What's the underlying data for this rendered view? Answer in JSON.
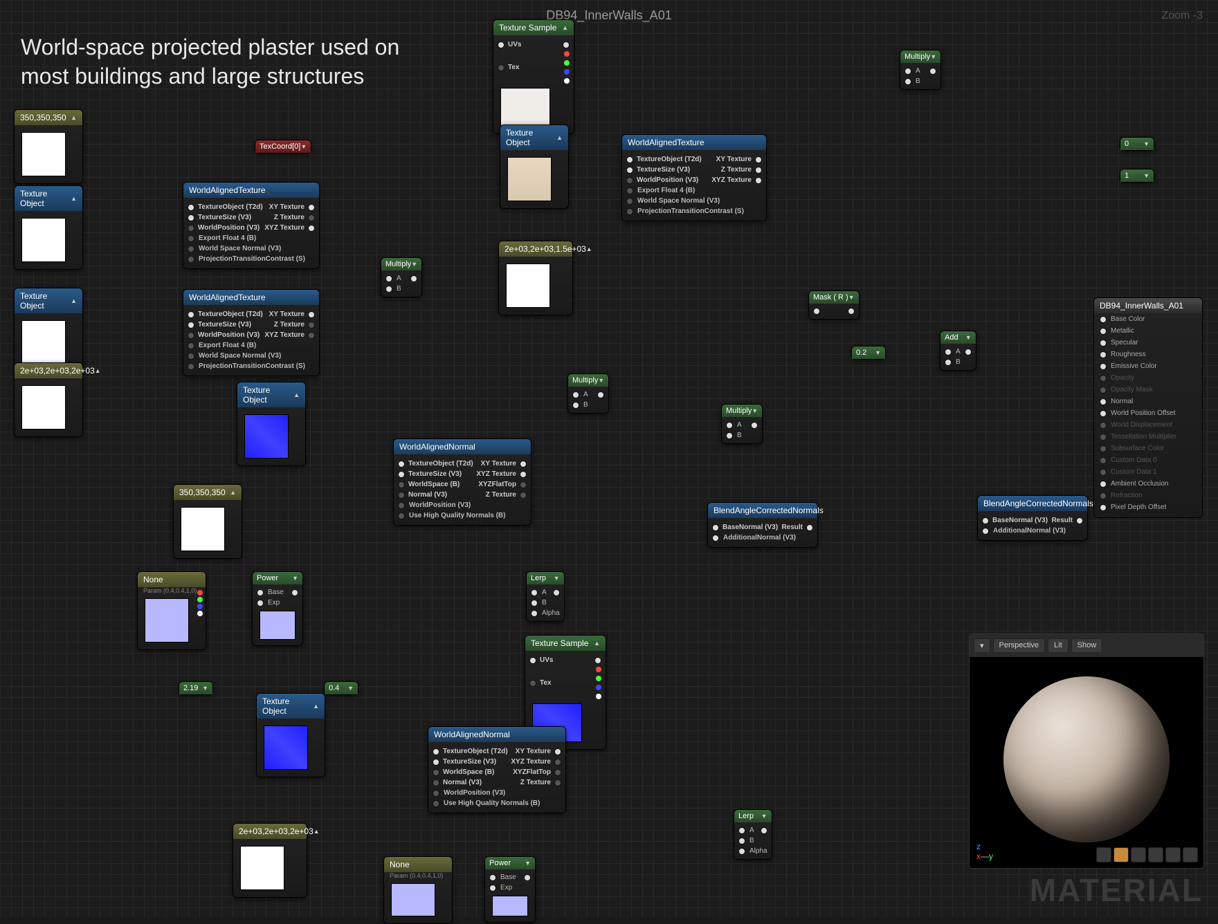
{
  "header": {
    "title": "DB94_InnerWalls_A01",
    "zoom": "Zoom -3"
  },
  "caption": {
    "line1": "World-space projected plaster used on",
    "line2": "most buildings and large structures"
  },
  "watermark": "MATERIAL",
  "preview": {
    "perspective": "Perspective",
    "lit": "Lit",
    "show": "Show"
  },
  "wat": {
    "title": "WorldAlignedTexture",
    "in": [
      "TextureObject (T2d)",
      "TextureSize (V3)",
      "WorldPosition (V3)",
      "Export Float 4 (B)",
      "World Space Normal (V3)",
      "ProjectionTransitionContrast (S)"
    ],
    "out": [
      "XY Texture",
      "Z Texture",
      "XYZ Texture"
    ]
  },
  "wan": {
    "title": "WorldAlignedNormal",
    "in": [
      "TextureObject (T2d)",
      "TextureSize (V3)",
      "WorldSpace (B)",
      "Normal (V3)",
      "WorldPosition (V3)",
      "Use High Quality Normals (B)"
    ],
    "out": [
      "XY Texture",
      "XYZ Texture",
      "XYZFlatTop",
      "Z Texture"
    ]
  },
  "bacn": {
    "title": "BlendAngleCorrectedNormals",
    "in": [
      "BaseNormal (V3)",
      "AdditionalNormal (V3)"
    ],
    "out": "Result"
  },
  "texsamp": {
    "title": "Texture Sample",
    "uvs": "UVs",
    "tex": "Tex"
  },
  "texobj": "Texture Object",
  "texcoord": "TexCoord[0]",
  "multiply": {
    "title": "Multiply",
    "a": "A",
    "b": "B"
  },
  "add": {
    "title": "Add",
    "a": "A",
    "b": "B"
  },
  "mask": "Mask ( R )",
  "power": {
    "title": "Power",
    "base": "Base",
    "exp": "Exp"
  },
  "lerp": {
    "title": "Lerp",
    "a": "A",
    "b": "B",
    "alpha": "Alpha"
  },
  "consts": {
    "c350": "350,350,350",
    "c2e3a": "2e+03,2e+03,2e+03",
    "c2e3b": "2e+03,2e+03,1.5e+03",
    "c2e3c": "2e+03,2e+03,2e+03",
    "c0": "0",
    "c1": "1",
    "c02": "0.2",
    "c219": "2.19",
    "c04": "0.4"
  },
  "param": {
    "none": "None",
    "sub": "Param (0.4,0.4,1,0)"
  },
  "output": {
    "title": "DB94_InnerWalls_A01",
    "pins": [
      "Base Color",
      "Metallic",
      "Specular",
      "Roughness",
      "Emissive Color",
      "Opacity",
      "Opacity Mask",
      "Normal",
      "World Position Offset",
      "World Displacement",
      "Tessellation Multiplier",
      "Subsurface Color",
      "Custom Data 0",
      "Custom Data 1",
      "Ambient Occlusion",
      "Refraction",
      "Pixel Depth Offset"
    ],
    "active": [
      0,
      1,
      2,
      3,
      4,
      7,
      8,
      14,
      16
    ]
  }
}
